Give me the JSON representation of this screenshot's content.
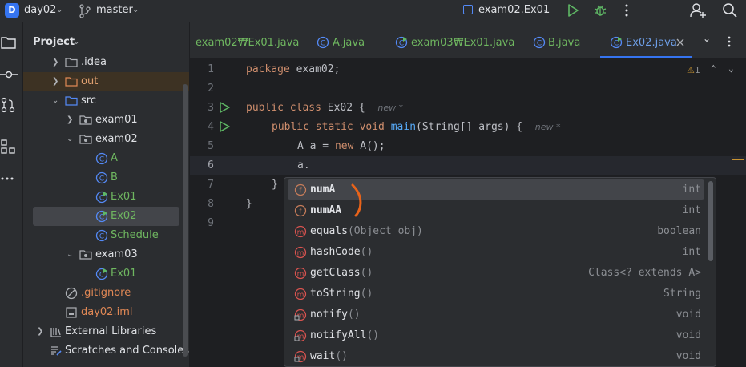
{
  "titlebar": {
    "project_badge": "D",
    "project_name": "day02",
    "branch": "master",
    "run_config": "exam02.Ex01"
  },
  "project_panel": {
    "header": "Project",
    "items": [
      {
        "label": ".idea"
      },
      {
        "label": "out"
      },
      {
        "label": "src"
      },
      {
        "label": "exam01"
      },
      {
        "label": "exam02"
      },
      {
        "label": "A"
      },
      {
        "label": "B"
      },
      {
        "label": "Ex01"
      },
      {
        "label": "Ex02"
      },
      {
        "label": "Schedule"
      },
      {
        "label": "exam03"
      },
      {
        "label": "Ex01"
      },
      {
        "label": ".gitignore"
      },
      {
        "label": "day02.iml"
      },
      {
        "label": "External Libraries"
      },
      {
        "label": "Scratches and Consoles"
      }
    ]
  },
  "tabs": [
    {
      "label": "exam02₩Ex01.java"
    },
    {
      "label": "A.java"
    },
    {
      "label": "exam03₩Ex01.java"
    },
    {
      "label": "B.java"
    },
    {
      "label": "Ex02.java"
    }
  ],
  "editor": {
    "line_numbers": [
      "1",
      "2",
      "3",
      "4",
      "5",
      "6",
      "7",
      "8",
      "9"
    ],
    "code": {
      "l1_kw": "package",
      "l1_rest": " exam02;",
      "l3_kw": "public class",
      "l3_rest": " Ex02 {",
      "l4_kw": "public static void",
      "l4_fn": "main",
      "l4_rest": "(String[] args) {",
      "l5_a": "A a = ",
      "l5_kw": "new",
      "l5_b": " A();",
      "l6": "a.",
      "l7": "}",
      "l8": "}"
    },
    "hint_new": "new *",
    "warnings_count": "1"
  },
  "completion": {
    "items": [
      {
        "icon": "field",
        "name": "numA",
        "params": "",
        "type": "int"
      },
      {
        "icon": "field",
        "name": "numAA",
        "params": "",
        "type": "int"
      },
      {
        "icon": "method",
        "name": "equals",
        "params": "(Object obj)",
        "type": "boolean"
      },
      {
        "icon": "method",
        "name": "hashCode",
        "params": "()",
        "type": "int"
      },
      {
        "icon": "method",
        "name": "getClass",
        "params": "()",
        "type": "Class<? extends A>"
      },
      {
        "icon": "method",
        "name": "toString",
        "params": "()",
        "type": "String"
      },
      {
        "icon": "method-lock",
        "name": "notify",
        "params": "()",
        "type": "void"
      },
      {
        "icon": "method-lock",
        "name": "notifyAll",
        "params": "()",
        "type": "void"
      },
      {
        "icon": "method-lock",
        "name": "wait",
        "params": "()",
        "type": "void"
      }
    ]
  },
  "colors": {
    "accent": "#3574f0",
    "field_icon": "#c77d5a",
    "method_icon": "#d9534f",
    "annotation": "#e8631a"
  }
}
